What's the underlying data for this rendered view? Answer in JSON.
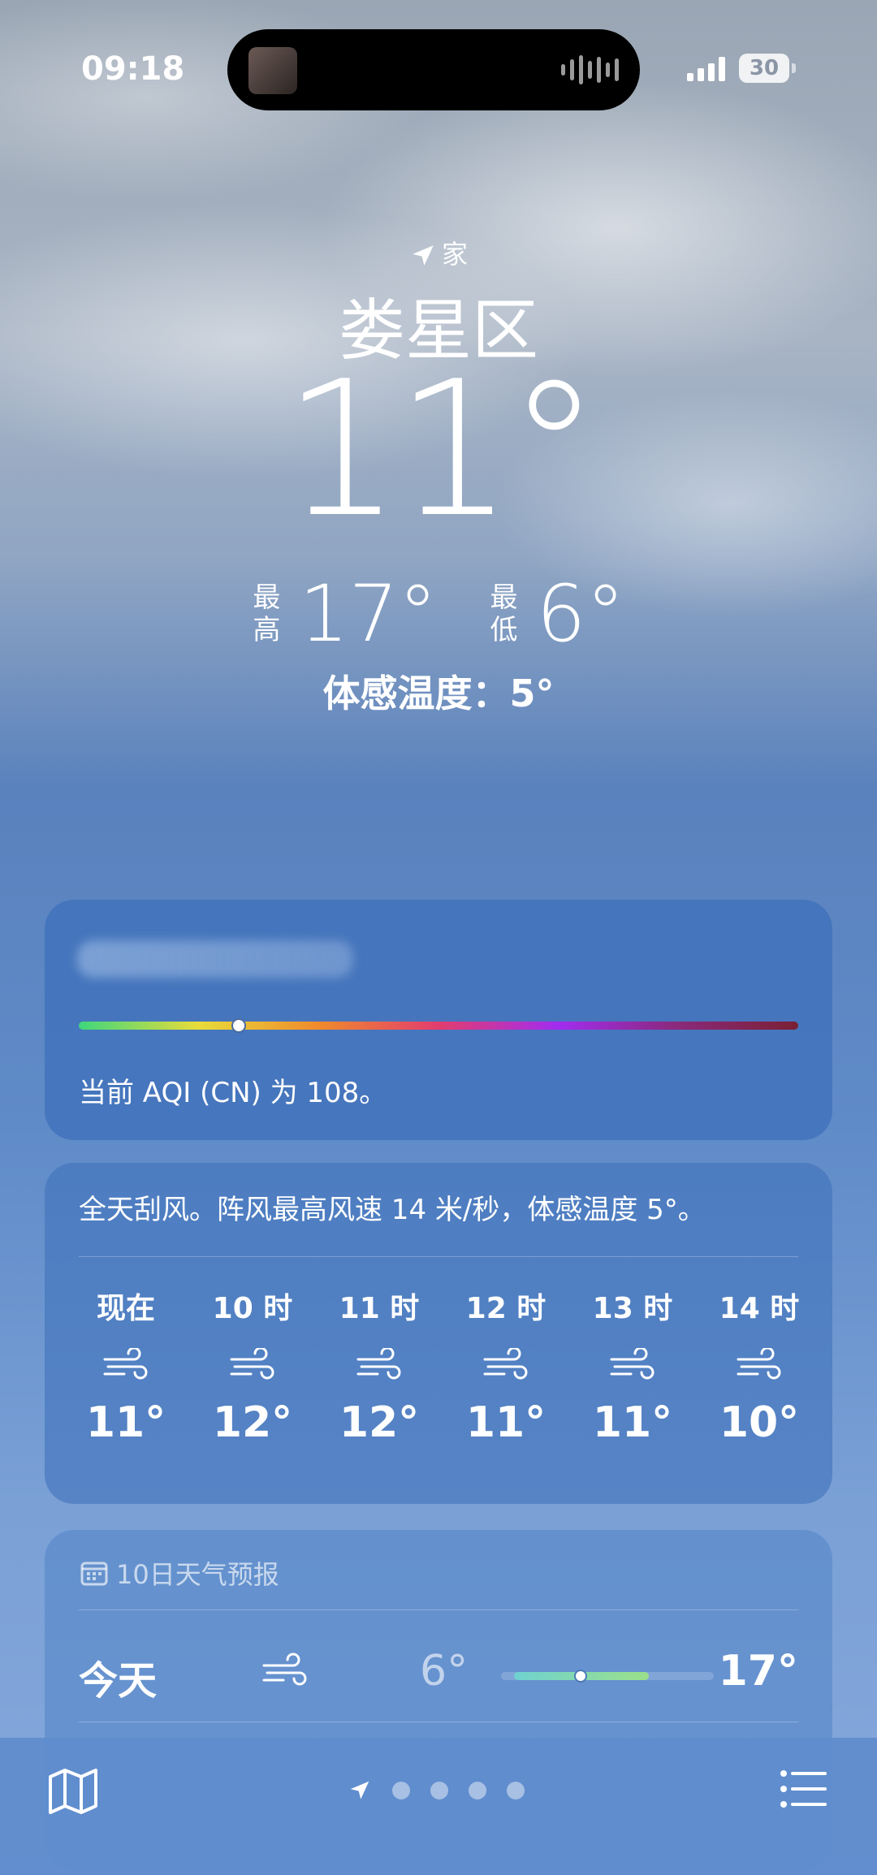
{
  "status": {
    "time": "09:18",
    "battery": "30"
  },
  "header": {
    "location_label": "家",
    "city": "娄星区",
    "temperature": "11°",
    "high_label_1": "最",
    "high_label_2": "高",
    "high": "17°",
    "low_label_1": "最",
    "low_label_2": "低",
    "low": "6°",
    "feels_like": "体感温度：5°"
  },
  "aqi": {
    "description": "当前 AQI (CN) 为 108。",
    "level_position": 0.22,
    "scale_colors": [
      "#3ed77d",
      "#e8dc3a",
      "#f08a2c",
      "#e23d6e",
      "#a22cf0",
      "#8a2a7a",
      "#7a2034"
    ]
  },
  "wind": {
    "summary": "全天刮风。阵风最高风速 14 米/秒，体感温度 5°。",
    "hours": [
      {
        "label": "现在",
        "icon": "wind-icon",
        "temp": "11°"
      },
      {
        "label": "10 时",
        "icon": "wind-icon",
        "temp": "12°"
      },
      {
        "label": "11 时",
        "icon": "wind-icon",
        "temp": "12°"
      },
      {
        "label": "12 时",
        "icon": "wind-icon",
        "temp": "11°"
      },
      {
        "label": "13 时",
        "icon": "wind-icon",
        "temp": "11°"
      },
      {
        "label": "14 时",
        "icon": "wind-icon",
        "temp": "10°"
      }
    ]
  },
  "forecast": {
    "title": "10日天气预报",
    "icon": "calendar-icon",
    "rows": [
      {
        "day": "今天",
        "icon": "wind-icon",
        "low": "6°",
        "high": "17°"
      }
    ]
  },
  "tabbar": {
    "map_icon": "map-icon",
    "location_icon": "location-arrow-icon",
    "list_icon": "list-icon",
    "page_count": 4
  }
}
